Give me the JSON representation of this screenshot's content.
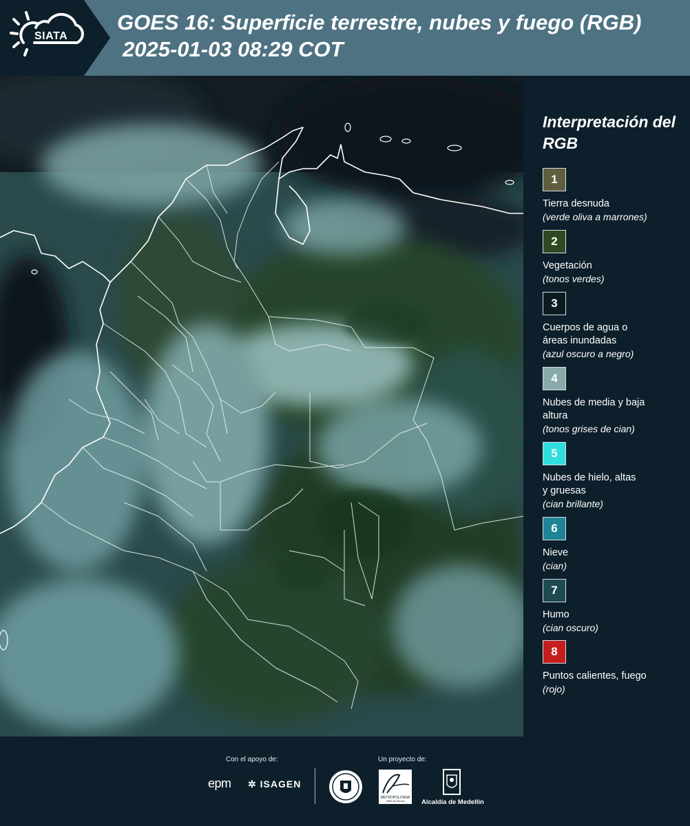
{
  "header": {
    "logo_text": "SIATA",
    "title": "GOES 16: Superficie terrestre, nubes y fuego (RGB)",
    "subtitle": "2025-01-03 08:29 COT"
  },
  "legend": {
    "title": "Interpretación del RGB",
    "items": [
      {
        "num": "1",
        "label": "Tierra desnuda",
        "sub": "(verde oliva a marrones)",
        "color": "#5f5e40"
      },
      {
        "num": "2",
        "label": "Vegetación",
        "sub": "(tonos verdes)",
        "color": "#2d4a22"
      },
      {
        "num": "3",
        "label": "Cuerpos de agua o áreas inundadas",
        "sub": "(azul oscuro a negro)",
        "color": "#0c1a22"
      },
      {
        "num": "4",
        "label": "Nubes de media y baja altura",
        "sub": "(tonos grises de cian)",
        "color": "#8aa9aa"
      },
      {
        "num": "5",
        "label": "Nubes de hielo, altas y gruesas",
        "sub": "(cian brillante)",
        "color": "#2fdede"
      },
      {
        "num": "6",
        "label": "Nieve",
        "sub": "(cian)",
        "color": "#1f8498"
      },
      {
        "num": "7",
        "label": "Humo",
        "sub": "(cian oscuro)",
        "color": "#1d4b50"
      },
      {
        "num": "8",
        "label": "Puntos calientes, fuego",
        "sub": "(rojo)",
        "color": "#c41e1e"
      }
    ]
  },
  "footer": {
    "support_caption": "Con el apoyo de:",
    "project_caption": "Un proyecto de:",
    "epm": "epm",
    "isagen": "ISAGEN",
    "area_text": "METROPOLITANA",
    "area_sub": "Valle de Aburrá",
    "alcaldia": "Alcaldía de Medellín"
  },
  "colors": {
    "header_bg": "#4e7282",
    "page_bg": "#0c1f2a"
  }
}
